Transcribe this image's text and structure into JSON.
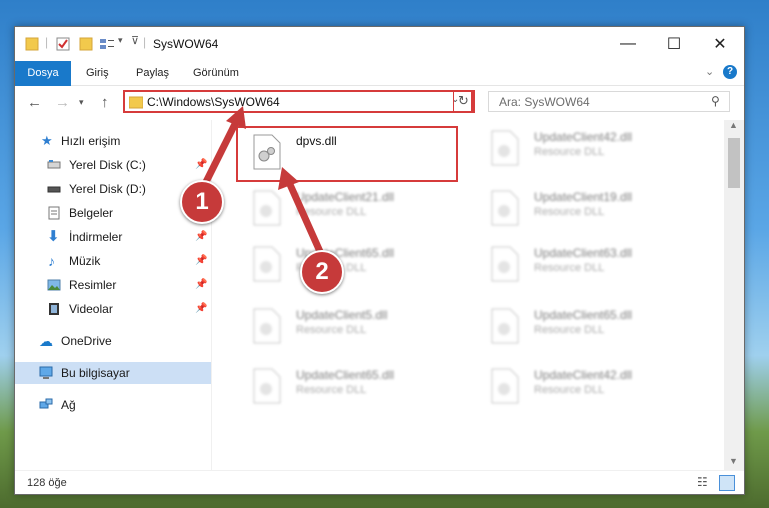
{
  "window": {
    "title": "SysWOW64"
  },
  "ribbon": {
    "tabs": [
      "Dosya",
      "Giriş",
      "Paylaş",
      "Görünüm"
    ]
  },
  "navigation": {
    "address": "C:\\Windows\\SysWOW64",
    "search_placeholder": "Ara: SysWOW64"
  },
  "sidebar": {
    "items": [
      {
        "label": "Hızlı erişim",
        "icon": "star-icon"
      },
      {
        "label": "Yerel Disk (C:)",
        "icon": "drive-icon",
        "pinned": true
      },
      {
        "label": "Yerel Disk (D:)",
        "icon": "drive-icon",
        "pinned": false
      },
      {
        "label": "Belgeler",
        "icon": "documents-icon",
        "pinned": true
      },
      {
        "label": "İndirmeler",
        "icon": "download-icon",
        "pinned": true
      },
      {
        "label": "Müzik",
        "icon": "music-icon",
        "pinned": true
      },
      {
        "label": "Resimler",
        "icon": "pictures-icon",
        "pinned": true
      },
      {
        "label": "Videolar",
        "icon": "videos-icon",
        "pinned": true
      },
      {
        "label": "OneDrive",
        "icon": "cloud-icon"
      },
      {
        "label": "Bu bilgisayar",
        "icon": "computer-icon",
        "selected": true
      },
      {
        "label": "Ağ",
        "icon": "network-icon"
      }
    ]
  },
  "files": {
    "highlighted": {
      "name": "dpvs.dll"
    },
    "col1": [
      {
        "name": "UpdateClient21.dll",
        "type": "Resource DLL"
      },
      {
        "name": "UpdateClient65.dll",
        "type": "Resource DLL"
      },
      {
        "name": "UpdateClient5.dll",
        "type": "Resource DLL"
      },
      {
        "name": "UpdateClient65.dll",
        "type": "Resource DLL"
      }
    ],
    "col2": [
      {
        "name": "UpdateClient42.dll",
        "type": "Resource DLL"
      },
      {
        "name": "UpdateClient19.dll",
        "type": "Resource DLL"
      },
      {
        "name": "UpdateClient63.dll",
        "type": "Resource DLL"
      },
      {
        "name": "UpdateClient65.dll",
        "type": "Resource DLL"
      },
      {
        "name": "UpdateClient42.dll",
        "type": "Resource DLL"
      }
    ]
  },
  "status": {
    "count": "128 öğe"
  },
  "callouts": [
    "1",
    "2"
  ],
  "colors": {
    "accent": "#1979ca",
    "highlight": "#d63b3b",
    "selection": "#ccdff5"
  }
}
